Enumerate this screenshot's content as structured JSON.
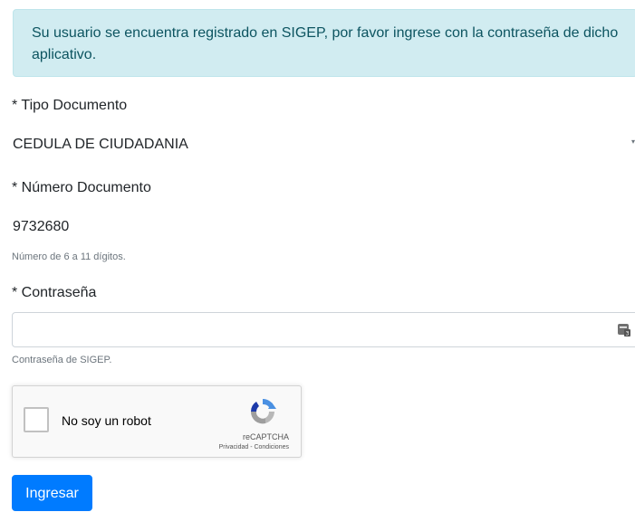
{
  "alert": {
    "message": "Su usuario se encuentra registrado en SIGEP, por favor ingrese con la contraseña de dicho aplicativo."
  },
  "form": {
    "tipo_documento": {
      "label": "* Tipo Documento",
      "value": "CEDULA DE CIUDADANIA"
    },
    "numero_documento": {
      "label": "* Número Documento",
      "value": "9732680",
      "help": "Número de 6 a 11 dígitos."
    },
    "contrasena": {
      "label": "* Contraseña",
      "value": "",
      "help": "Contraseña de SIGEP.",
      "icon": "password-manager-icon"
    }
  },
  "recaptcha": {
    "label": "No soy un robot",
    "brand": "reCAPTCHA",
    "terms": "Privacidad - Condiciones",
    "icon": "recaptcha-logo-icon"
  },
  "submit_label": "Ingresar",
  "colors": {
    "alert_bg": "#d1ecf1",
    "alert_text": "#0c5460",
    "primary": "#007bff"
  }
}
